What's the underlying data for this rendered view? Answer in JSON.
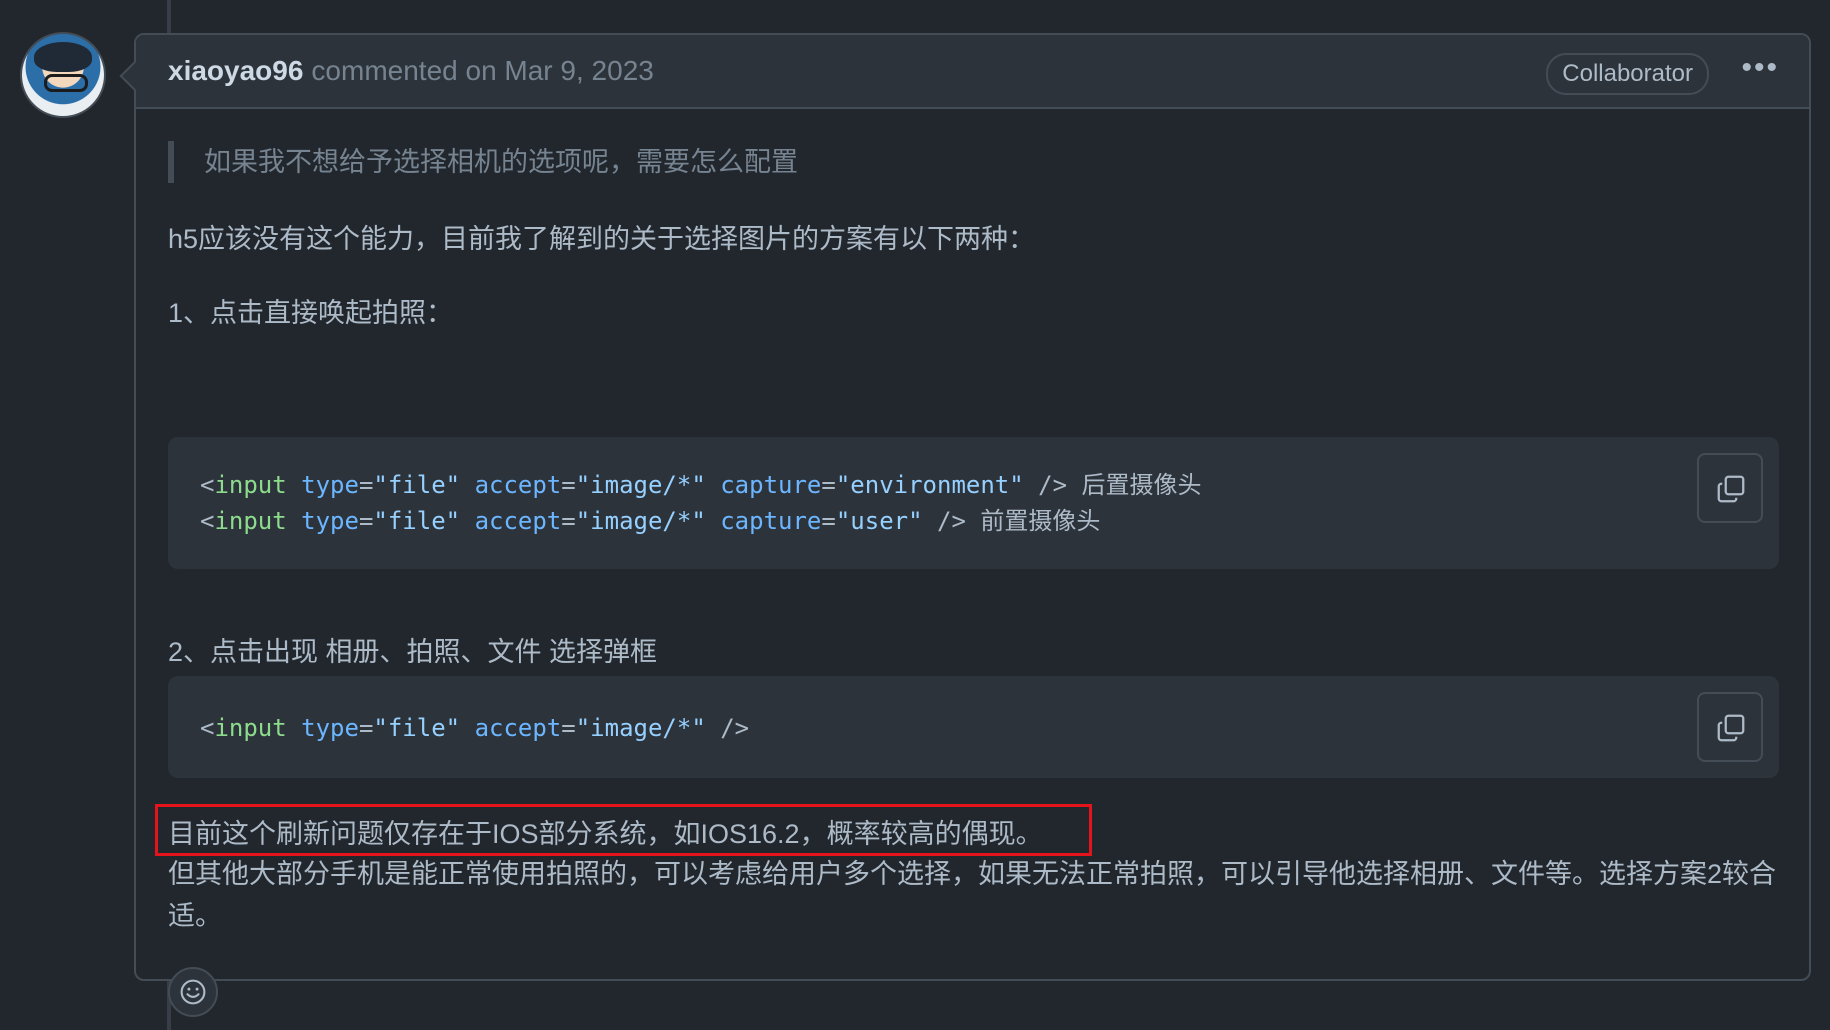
{
  "comment": {
    "author": "xiaoyao96",
    "meta": "commented on Mar 9, 2023",
    "badge": "Collaborator",
    "more_icon": "kebab-horizontal",
    "quote": "如果我不想给予选择相机的选项呢，需要怎么配置",
    "paragraphs": [
      "h5应该没有这个能力，目前我了解到的关于选择图片的方案有以下两种：",
      "1、点击直接唤起拍照：",
      "2、点击出现 相册、拍照、文件 选择弹框",
      "目前这个刷新问题仅存在于IOS部分系统，如IOS16.2，概率较高的偶现。",
      "但其他大部分手机是能正常使用拍照的，可以考虑给用户多个选择，如果无法正常拍照，可以引导他选择相册、文件等。选择方案2较合适。"
    ],
    "code_blocks": [
      {
        "lines": [
          {
            "tag": "input",
            "attrs": [
              {
                "name": "type",
                "value": "file"
              },
              {
                "name": "accept",
                "value": "image/*"
              },
              {
                "name": "capture",
                "value": "environment"
              }
            ],
            "suffix": " 后置摄像头"
          },
          {
            "tag": "input",
            "attrs": [
              {
                "name": "type",
                "value": "file"
              },
              {
                "name": "accept",
                "value": "image/*"
              },
              {
                "name": "capture",
                "value": "user"
              }
            ],
            "suffix": " 前置摄像头"
          }
        ],
        "copy_icon": "copy"
      },
      {
        "lines": [
          {
            "tag": "input",
            "attrs": [
              {
                "name": "type",
                "value": "file"
              },
              {
                "name": "accept",
                "value": "image/*"
              }
            ],
            "suffix": ""
          }
        ],
        "copy_icon": "copy"
      }
    ],
    "highlight_color": "#e5131a",
    "reaction_icon": "smiley"
  }
}
